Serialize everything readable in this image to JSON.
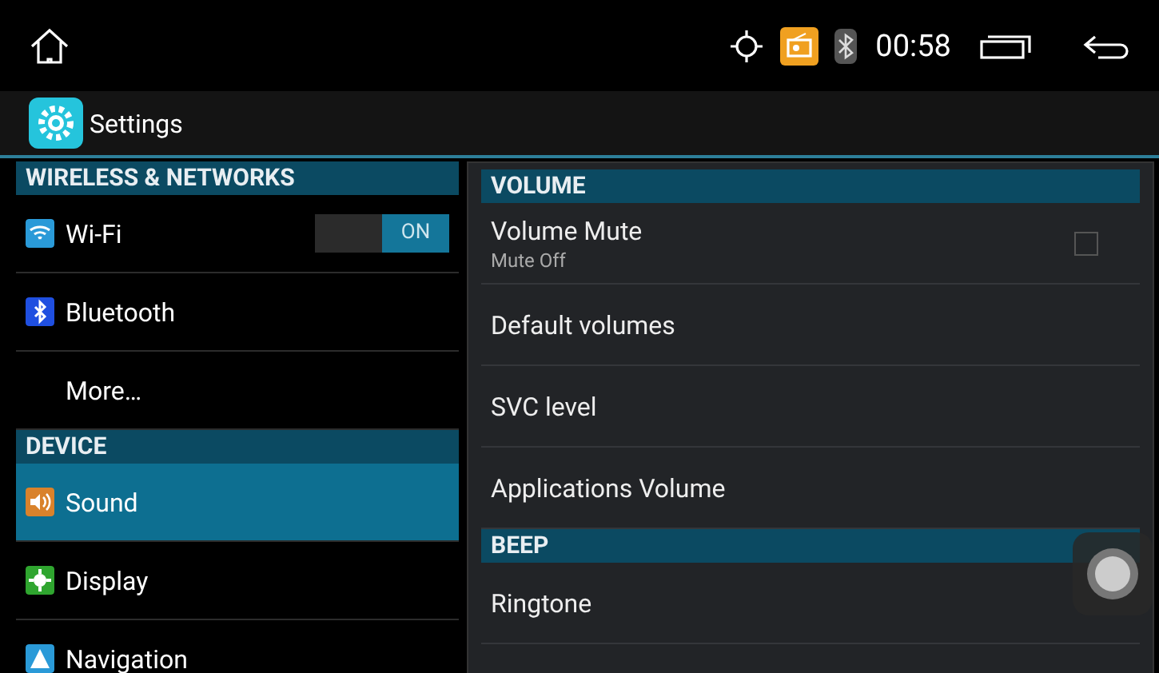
{
  "status_bar": {
    "time": "00:58"
  },
  "app_bar": {
    "title": "Settings"
  },
  "sidebar": {
    "items": [
      {
        "kind": "header",
        "label": "WIRELESS & NETWORKS"
      },
      {
        "kind": "toggle",
        "label": "Wi-Fi",
        "selected": false,
        "color": "#2a9ad8",
        "toggle": {
          "on": true,
          "label": "ON"
        }
      },
      {
        "kind": "item",
        "label": "Bluetooth",
        "selected": false,
        "color": "#1f4fe0"
      },
      {
        "kind": "item",
        "label": "More…",
        "selected": false
      },
      {
        "kind": "header",
        "label": "DEVICE"
      },
      {
        "kind": "item",
        "label": "Sound",
        "selected": true,
        "color": "#d9822b"
      },
      {
        "kind": "item",
        "label": "Display",
        "selected": false,
        "color": "#2fa52f"
      },
      {
        "kind": "item",
        "label": "Navigation",
        "selected": false,
        "color": "#2a9ad8"
      }
    ]
  },
  "content": {
    "items": [
      {
        "kind": "header",
        "label": "VOLUME"
      },
      {
        "kind": "checkbox",
        "label": "Volume Mute",
        "summary": "Mute Off",
        "checked": false
      },
      {
        "kind": "item",
        "label": "Default volumes"
      },
      {
        "kind": "item",
        "label": "SVC level"
      },
      {
        "kind": "item",
        "label": "Applications Volume"
      },
      {
        "kind": "header",
        "label": "BEEP"
      },
      {
        "kind": "item",
        "label": "Ringtone"
      }
    ]
  }
}
